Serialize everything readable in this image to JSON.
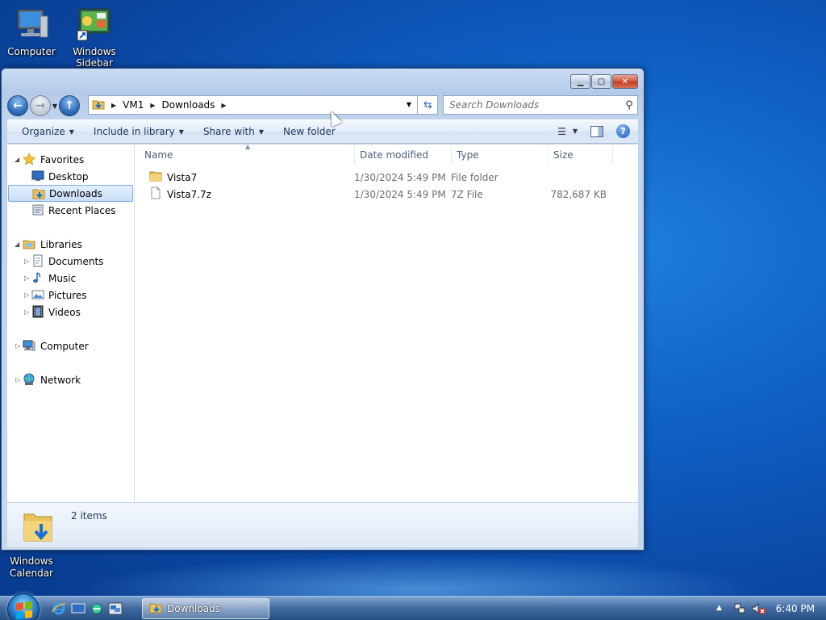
{
  "desktop": {
    "icons": [
      {
        "label": "Computer",
        "icon": "computer-icon"
      },
      {
        "label": "Windows Sidebar",
        "icon": "windows-sidebar-icon"
      },
      {
        "label": "Windows Calendar",
        "icon": "windows-calendar-icon"
      }
    ]
  },
  "window": {
    "address": {
      "segments": [
        "VM1",
        "Downloads"
      ]
    },
    "search": {
      "placeholder": "Search Downloads"
    },
    "commands": {
      "organize": "Organize",
      "include_in_library": "Include in library",
      "share_with": "Share with",
      "new_folder": "New folder"
    },
    "nav_pane": {
      "favorites": {
        "label": "Favorites",
        "items": [
          "Desktop",
          "Downloads",
          "Recent Places"
        ],
        "selected": "Downloads"
      },
      "libraries": {
        "label": "Libraries",
        "items": [
          "Documents",
          "Music",
          "Pictures",
          "Videos"
        ]
      },
      "computer": "Computer",
      "network": "Network"
    },
    "columns": [
      "Name",
      "Date modified",
      "Type",
      "Size"
    ],
    "files": [
      {
        "name": "Vista7",
        "date_modified": "1/30/2024 5:49 PM",
        "type": "File folder",
        "size": "",
        "icon": "folder-icon"
      },
      {
        "name": "Vista7.7z",
        "date_modified": "1/30/2024 5:49 PM",
        "type": "7Z File",
        "size": "782,687 KB",
        "icon": "file-icon"
      }
    ],
    "status": {
      "item_count": "2 items"
    }
  },
  "taskbar": {
    "active_task": "Downloads",
    "clock": "6:40 PM"
  }
}
